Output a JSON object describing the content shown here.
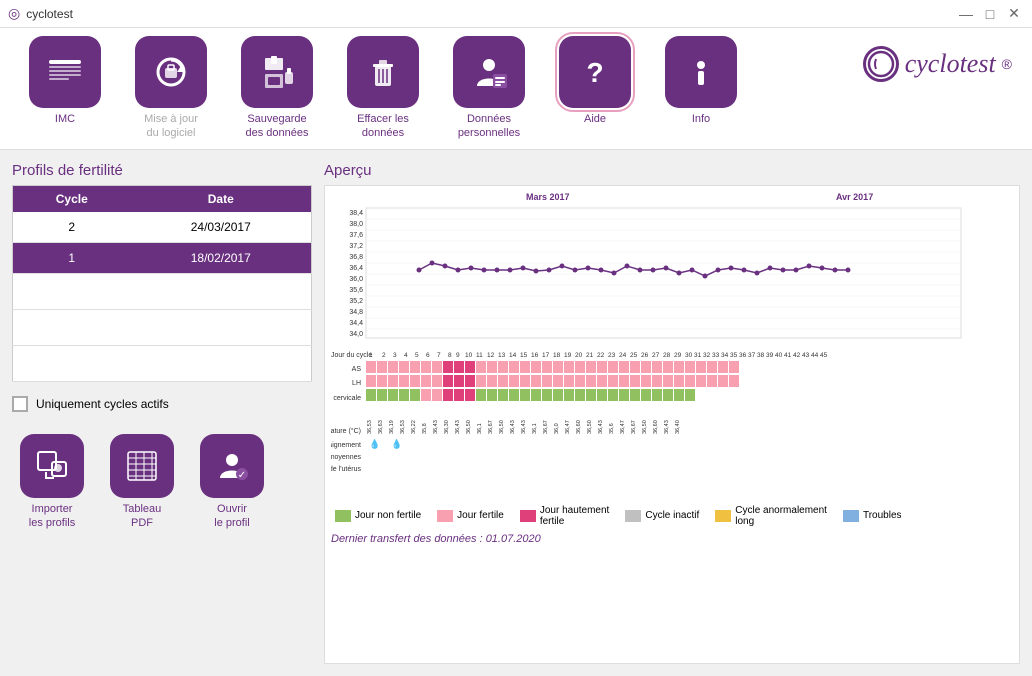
{
  "titlebar": {
    "title": "cyclotest",
    "minimize": "—",
    "maximize": "□",
    "close": "✕"
  },
  "toolbar": {
    "items": [
      {
        "id": "imc",
        "label": "IMC",
        "icon": "📏",
        "active": false
      },
      {
        "id": "mise-a-jour",
        "label": "Mise à jour\ndu logiciel",
        "icon": "🔄",
        "active": false
      },
      {
        "id": "sauvegarde",
        "label": "Sauvegarde\ndes données",
        "icon": "💾",
        "active": false
      },
      {
        "id": "effacer",
        "label": "Effacer les\ndonnées",
        "icon": "🗑",
        "active": false
      },
      {
        "id": "donnees",
        "label": "Données\npersonnelles",
        "icon": "👤",
        "active": false
      },
      {
        "id": "aide",
        "label": "Aide",
        "icon": "?",
        "active": true
      },
      {
        "id": "info",
        "label": "Info",
        "icon": "ℹ",
        "active": false
      }
    ]
  },
  "logo": {
    "text": "cyclotest",
    "reg": "®"
  },
  "left_panel": {
    "title": "Profils de fertilité",
    "table": {
      "headers": [
        "Cycle",
        "Date"
      ],
      "rows": [
        {
          "cycle": "2",
          "date": "24/03/2017",
          "selected": false
        },
        {
          "cycle": "1",
          "date": "18/02/2017",
          "selected": true
        },
        {
          "cycle": "",
          "date": "",
          "selected": false
        },
        {
          "cycle": "",
          "date": "",
          "selected": false
        },
        {
          "cycle": "",
          "date": "",
          "selected": false
        }
      ]
    },
    "checkbox_label": "Uniquement cycles actifs",
    "buttons": [
      {
        "id": "importer",
        "label": "Importer\nles profils",
        "icon": "⬇"
      },
      {
        "id": "tableau",
        "label": "Tableau\nPDF",
        "icon": "📅"
      },
      {
        "id": "ouvrir",
        "label": "Ouvrir\nle profil",
        "icon": "👩"
      }
    ]
  },
  "right_panel": {
    "title": "Aperçu",
    "months": [
      "Mars 2017",
      "Avr 2017"
    ],
    "y_axis_labels": [
      "38,4",
      "38,0",
      "37,6",
      "37,2",
      "36,8",
      "36,4",
      "36,0",
      "35,6",
      "35,2",
      "34,8",
      "34,4",
      "34,0"
    ],
    "day_numbers": "1 2 3 4 5 6 7 8 9 10 11 12 13 14 15 16 17 18 19 20 21 22 23 24 25 26 27 28 29 30 31 32 33 34 35 36 37 38 39 40 41 42 43 44 45",
    "labels": {
      "jour_cycle": "Jour du cycle",
      "as": "AS",
      "lh": "LH",
      "glaire": "Glaire cervicale",
      "temperature": "Température (°C)",
      "saignement": "Saignement",
      "douleurs": "Douleurs moyennes",
      "col": "Col de l'utérus"
    },
    "legend": [
      {
        "color": "#90c060",
        "label": "Jour non fertile"
      },
      {
        "color": "#f8a0b0",
        "label": "Jour fertile"
      },
      {
        "color": "#e0407a",
        "label": "Jour hautement\nfertile"
      },
      {
        "color": "#c0c0c0",
        "label": "Cycle inactif"
      },
      {
        "color": "#f0c040",
        "label": "Cycle anormalement\nlong"
      },
      {
        "color": "#80b0e0",
        "label": "Troubles"
      }
    ],
    "transfer_text": "Dernier transfert des données : 01.07.2020"
  }
}
